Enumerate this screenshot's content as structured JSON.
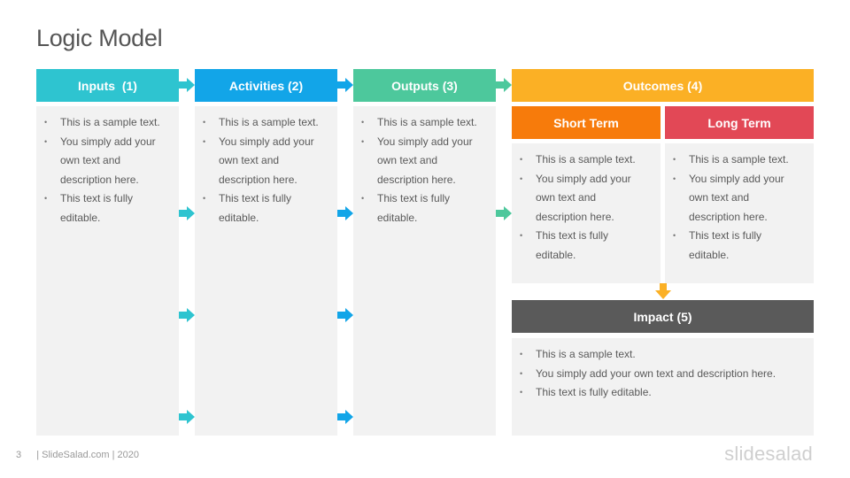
{
  "slide": {
    "title": "Logic Model",
    "page_number": "3",
    "footer": "| SlideSalad.com | 2020",
    "brand": "slidesalad"
  },
  "colors": {
    "inputs": "#2EC4D0",
    "activities": "#12A5E8",
    "outputs": "#4DC89C",
    "outcomes": "#FBB025",
    "short_term": "#F77B0B",
    "long_term": "#E24856",
    "impact": "#5A5A5A",
    "panel": "#F2F2F2"
  },
  "columns": [
    {
      "id": "inputs",
      "label": "Inputs  (1)",
      "bullets": [
        "This is a sample text.",
        "You simply add your own text and description here.",
        "This text is fully editable."
      ]
    },
    {
      "id": "activities",
      "label": "Activities (2)",
      "bullets": [
        "This is a sample text.",
        "You simply add your own text and description here.",
        "This text is fully editable."
      ]
    },
    {
      "id": "outputs",
      "label": "Outputs (3)",
      "bullets": [
        "This is a sample text.",
        "You simply add your own text and description here.",
        "This text is fully editable."
      ]
    }
  ],
  "outcomes": {
    "label": "Outcomes (4)",
    "short_term": {
      "label": "Short Term",
      "bullets": [
        "This is a sample text.",
        "You simply add your own text and description here.",
        "This text is fully editable."
      ]
    },
    "long_term": {
      "label": "Long Term",
      "bullets": [
        "This is a sample text.",
        "You simply add your own text and description here.",
        "This text is fully editable."
      ]
    }
  },
  "impact": {
    "label": "Impact (5)",
    "bullets": [
      "This is a sample text.",
      "You simply add your own text and description here.",
      "This text is fully editable."
    ]
  },
  "icons": {
    "flow_arrow": "arrow-right-icon",
    "down_arrow": "arrow-down-icon"
  }
}
